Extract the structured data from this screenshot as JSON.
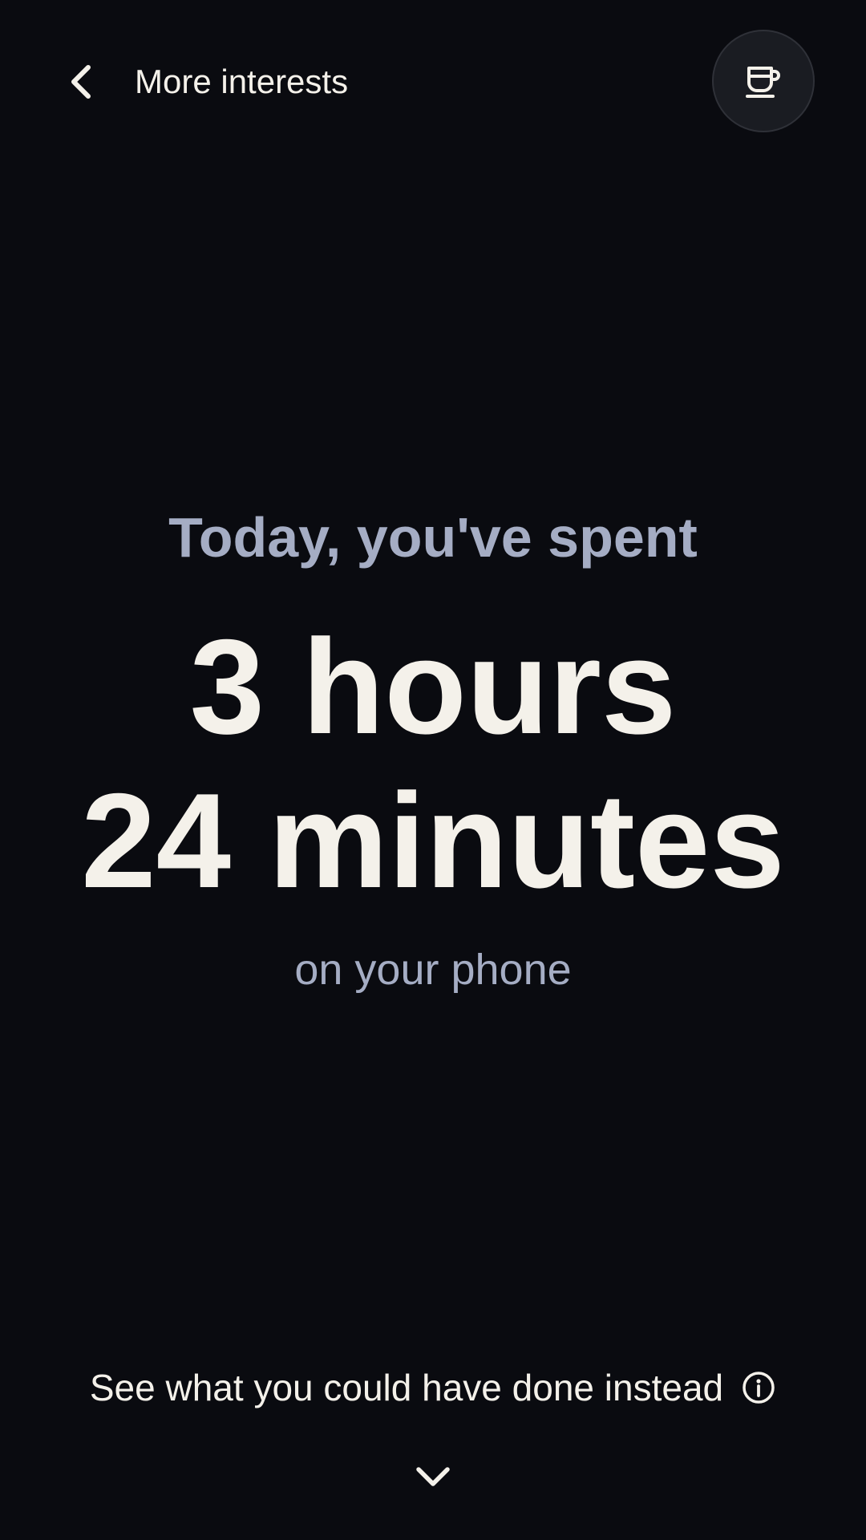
{
  "header": {
    "title": "More interests",
    "back_icon": "chevron-left-icon",
    "action_icon": "coffee-cup-icon"
  },
  "stats": {
    "intro": "Today, you've spent",
    "hours_text": "3 hours",
    "minutes_text": "24 minutes",
    "outro": "on your phone"
  },
  "footer": {
    "link_text": "See what you could have done instead",
    "info_icon": "info-icon",
    "expand_icon": "chevron-down-icon"
  },
  "colors": {
    "background": "#0a0b10",
    "primary_text": "#f4f1ea",
    "secondary_text": "#a5adc4",
    "button_bg": "#1a1c22"
  }
}
